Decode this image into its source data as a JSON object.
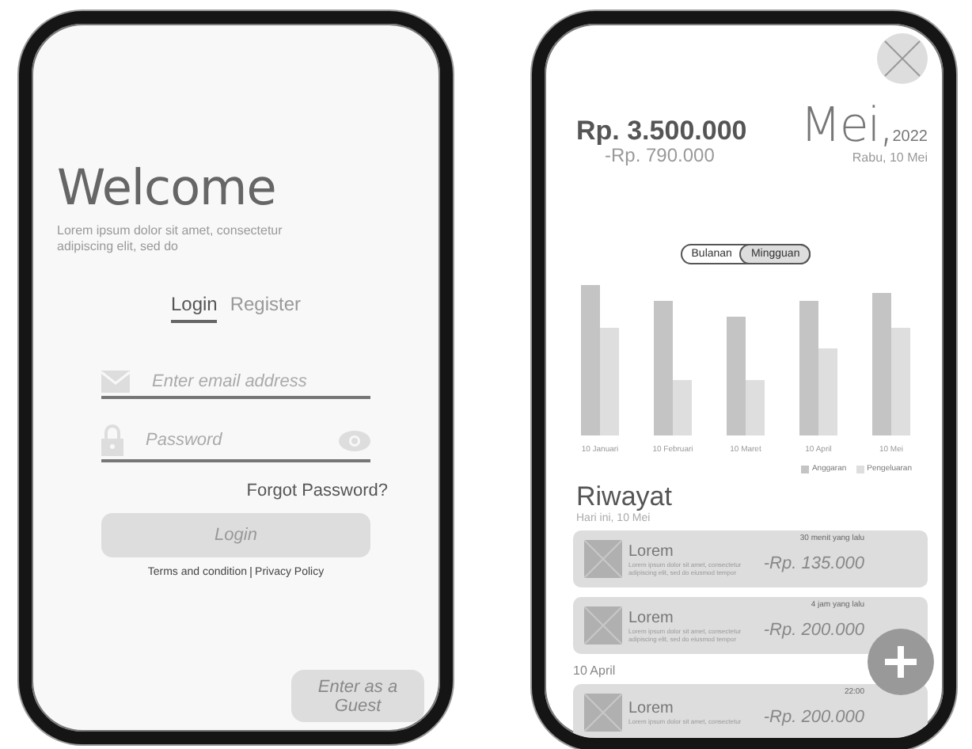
{
  "login_screen": {
    "title": "Welcome",
    "subtitle": "Lorem ipsum dolor sit amet, consectetur adipiscing elit, sed do",
    "tabs": [
      {
        "label": "Login",
        "selected": true
      },
      {
        "label": "Register",
        "selected": false
      }
    ],
    "email_field": {
      "placeholder": "Enter email address"
    },
    "password_field": {
      "placeholder": "Password"
    },
    "forgot_password": "Forgot Password?",
    "login_button": "Login",
    "links": [
      "Terms and condition",
      "Privacy Policy"
    ],
    "guest_button": "Enter as a Guest"
  },
  "dashboard_screen": {
    "balance": "Rp. 3.500.000",
    "spent": "-Rp. 790.000",
    "month": "Mei,",
    "year": "2022",
    "date": "Rabu, 10 Mei",
    "toggle": [
      {
        "label": "Bulanan",
        "selected": false
      },
      {
        "label": "Mingguan",
        "selected": true
      }
    ],
    "chart_labels": [
      "10 Januari",
      "10 Februari",
      "10 Maret",
      "10 April",
      "10 Mei"
    ],
    "legend": [
      {
        "label": "Anggaran",
        "color": "#c4c4c4"
      },
      {
        "label": "Pengeluaran",
        "color": "#dedede"
      }
    ],
    "history_title": "Riwayat",
    "groups": [
      {
        "date": "Hari ini, 10 Mei",
        "items": [
          {
            "time": "30 menit yang lalu",
            "title": "Lorem",
            "description": "Lorem ipsum dolor sit amet, consectetur adipiscing elit, sed do eiusmod tempor",
            "amount": "-Rp. 135.000"
          },
          {
            "time": "4 jam yang lalu",
            "title": "Lorem",
            "description": "Lorem ipsum dolor sit amet, consectetur adipiscing elit, sed do eiusmod tempor",
            "amount": "-Rp. 200.000"
          }
        ]
      },
      {
        "date": "10 April",
        "items": [
          {
            "time": "22:00",
            "title": "Lorem",
            "description": "Lorem ipsum dolor sit amet, consectetur",
            "amount": "-Rp. 200.000"
          }
        ]
      }
    ]
  }
}
